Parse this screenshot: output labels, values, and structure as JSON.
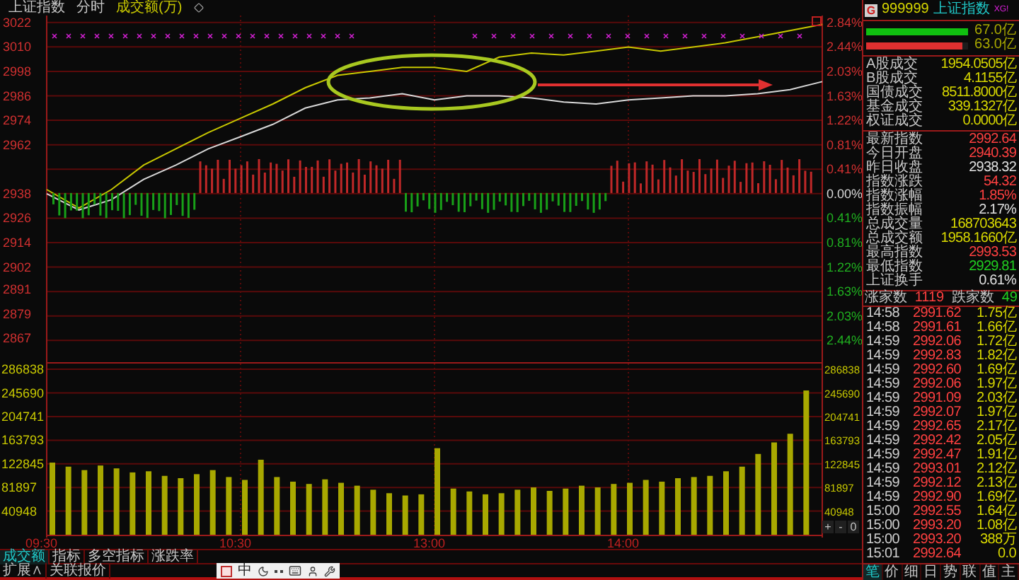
{
  "chart_header": {
    "title": "上证指数",
    "mode": "分时",
    "indicator": "成交额(万)"
  },
  "price_chart": {
    "chart_data": {
      "type": "line",
      "grid": true,
      "ylim": [
        2855,
        3024
      ],
      "yticks": [
        3022,
        3010,
        2998,
        2986,
        2974,
        2962,
        2938,
        2926,
        2914,
        2902,
        2891,
        2879,
        2867
      ],
      "series": [
        {
          "color": "#d8d8d8",
          "values": [
            2938,
            2930,
            2935,
            2945,
            2952,
            2960,
            2966,
            2972,
            2980,
            2984,
            2985,
            2987,
            2984,
            2986,
            2986,
            2985,
            2983,
            2982,
            2984,
            2985,
            2986,
            2986,
            2987,
            2989,
            2993
          ]
        },
        {
          "color": "#c8c800",
          "values": [
            2940,
            2931,
            2940,
            2952,
            2960,
            2968,
            2975,
            2982,
            2990,
            2996,
            2998,
            3000,
            3000,
            2998,
            3005,
            3007,
            3006,
            3008,
            3010,
            3008,
            3010,
            3012,
            3015,
            3018,
            3021
          ]
        }
      ]
    },
    "percent_labels": [
      {
        "label": "2.84%",
        "color": "#d03030"
      },
      {
        "label": "2.44%",
        "color": "#d03030"
      },
      {
        "label": "2.03%",
        "color": "#d03030"
      },
      {
        "label": "1.63%",
        "color": "#d03030"
      },
      {
        "label": "1.22%",
        "color": "#d03030"
      },
      {
        "label": "0.81%",
        "color": "#d03030"
      },
      {
        "label": "0.41%",
        "color": "#d03030"
      },
      {
        "label": "0.00%",
        "color": "#d8d8d8"
      },
      {
        "label": "0.41%",
        "color": "#20b020"
      },
      {
        "label": "0.81%",
        "color": "#20b020"
      },
      {
        "label": "1.22%",
        "color": "#20b020"
      },
      {
        "label": "1.63%",
        "color": "#20b020"
      },
      {
        "label": "2.03%",
        "color": "#20b020"
      },
      {
        "label": "2.44%",
        "color": "#20b020"
      }
    ]
  },
  "volume_chart": {
    "chart_data": {
      "type": "bar",
      "grid": true,
      "ylim": [
        0,
        286838
      ],
      "yticks": [
        286838,
        245690,
        204741,
        163793,
        122845,
        81897,
        40948
      ],
      "values": [
        125000,
        118000,
        112000,
        120000,
        115000,
        108000,
        110000,
        102000,
        98000,
        105000,
        112000,
        100000,
        95000,
        130000,
        100000,
        92000,
        88000,
        96000,
        90000,
        85000,
        78000,
        72000,
        68000,
        70000,
        150000,
        80000,
        75000,
        70000,
        72000,
        78000,
        82000,
        76000,
        80000,
        85000,
        82000,
        88000,
        90000,
        95000,
        92000,
        98000,
        100000,
        102000,
        110000,
        118000,
        140000,
        160000,
        175000,
        250000
      ]
    },
    "right_labels": [
      "286838",
      "245690",
      "204741",
      "163793",
      "122845",
      "81897",
      "40948"
    ],
    "zoom_buttons": [
      "+",
      "-",
      "0"
    ]
  },
  "time_axis": [
    "09:30",
    "10:30",
    "13:00",
    "14:00"
  ],
  "indicator_tabs": [
    {
      "label": "成交额",
      "selected": true
    },
    {
      "label": "指标",
      "selected": false
    },
    {
      "label": "多空指标",
      "selected": false
    },
    {
      "label": "涨跌率",
      "selected": false
    }
  ],
  "bottom_links": [
    "扩展∧",
    "关联报价"
  ],
  "ime_toolbar": {
    "mode": "中"
  },
  "quote_panel": {
    "badge": "G",
    "code": "999999",
    "name": "上证指数",
    "tag": "XG!",
    "flow_bars": [
      {
        "level": 1,
        "value": "67.0亿",
        "color": "#10c010"
      },
      {
        "level": 0.94,
        "value": "63.0亿",
        "color": "#e03030"
      }
    ],
    "turnover": [
      {
        "label": "A股成交",
        "value": "1954.0505亿",
        "color": "#d8d800"
      },
      {
        "label": "B股成交",
        "value": "4.1155亿",
        "color": "#d8d800"
      },
      {
        "label": "国债成交",
        "value": "8511.8000亿",
        "color": "#d8d800"
      },
      {
        "label": "基金成交",
        "value": "339.1327亿",
        "color": "#d8d800"
      },
      {
        "label": "权证成交",
        "value": "0.0000亿",
        "color": "#d8d800"
      }
    ],
    "stats": [
      {
        "label": "最新指数",
        "value": "2992.64",
        "color": "#ff4040"
      },
      {
        "label": "今日开盘",
        "value": "2940.39",
        "color": "#ff4040"
      },
      {
        "label": "昨日收盘",
        "value": "2938.32",
        "color": "#e0e0e0"
      },
      {
        "label": "指数涨跌",
        "value": "54.32",
        "color": "#ff4040"
      },
      {
        "label": "指数涨幅",
        "value": "1.85%",
        "color": "#ff4040"
      },
      {
        "label": "指数振幅",
        "value": "2.17%",
        "color": "#e0e0e0"
      },
      {
        "label": "总成交量",
        "value": "168703643",
        "color": "#d8d800"
      },
      {
        "label": "总成交额",
        "value": "1958.1660亿",
        "color": "#d8d800"
      },
      {
        "label": "最高指数",
        "value": "2993.53",
        "color": "#ff4040"
      },
      {
        "label": "最低指数",
        "value": "2929.81",
        "color": "#20d020"
      },
      {
        "label": "上证换手",
        "value": "0.61%",
        "color": "#e0e0e0"
      }
    ],
    "breadth": {
      "up_label": "涨家数",
      "up_value": "1119",
      "down_label": "跌家数",
      "down_value": "49"
    },
    "ticks": [
      {
        "time": "14:58",
        "price": "2991.62",
        "amount": "1.75亿"
      },
      {
        "time": "14:58",
        "price": "2991.61",
        "amount": "1.66亿"
      },
      {
        "time": "14:59",
        "price": "2992.06",
        "amount": "1.72亿"
      },
      {
        "time": "14:59",
        "price": "2992.83",
        "amount": "1.82亿"
      },
      {
        "time": "14:59",
        "price": "2992.60",
        "amount": "1.69亿"
      },
      {
        "time": "14:59",
        "price": "2992.06",
        "amount": "1.97亿"
      },
      {
        "time": "14:59",
        "price": "2991.09",
        "amount": "2.03亿"
      },
      {
        "time": "14:59",
        "price": "2992.07",
        "amount": "1.97亿"
      },
      {
        "time": "14:59",
        "price": "2992.65",
        "amount": "2.17亿"
      },
      {
        "time": "14:59",
        "price": "2992.42",
        "amount": "2.05亿"
      },
      {
        "time": "14:59",
        "price": "2992.47",
        "amount": "1.91亿"
      },
      {
        "time": "14:59",
        "price": "2993.01",
        "amount": "2.12亿"
      },
      {
        "time": "14:59",
        "price": "2992.12",
        "amount": "2.13亿"
      },
      {
        "time": "14:59",
        "price": "2992.90",
        "amount": "1.69亿"
      },
      {
        "time": "15:00",
        "price": "2992.55",
        "amount": "1.64亿"
      },
      {
        "time": "15:00",
        "price": "2993.20",
        "amount": "1.08亿"
      },
      {
        "time": "15:00",
        "price": "2993.20",
        "amount": "388万"
      },
      {
        "time": "15:01",
        "price": "2992.64",
        "amount": "0.0"
      }
    ],
    "panel_tabs": [
      {
        "label": "笔",
        "selected": true
      },
      {
        "label": "价",
        "selected": false
      },
      {
        "label": "细",
        "selected": false
      },
      {
        "label": "日",
        "selected": false
      },
      {
        "label": "势",
        "selected": false
      },
      {
        "label": "联",
        "selected": false
      },
      {
        "label": "值",
        "selected": false
      },
      {
        "label": "主",
        "selected": false
      }
    ]
  }
}
